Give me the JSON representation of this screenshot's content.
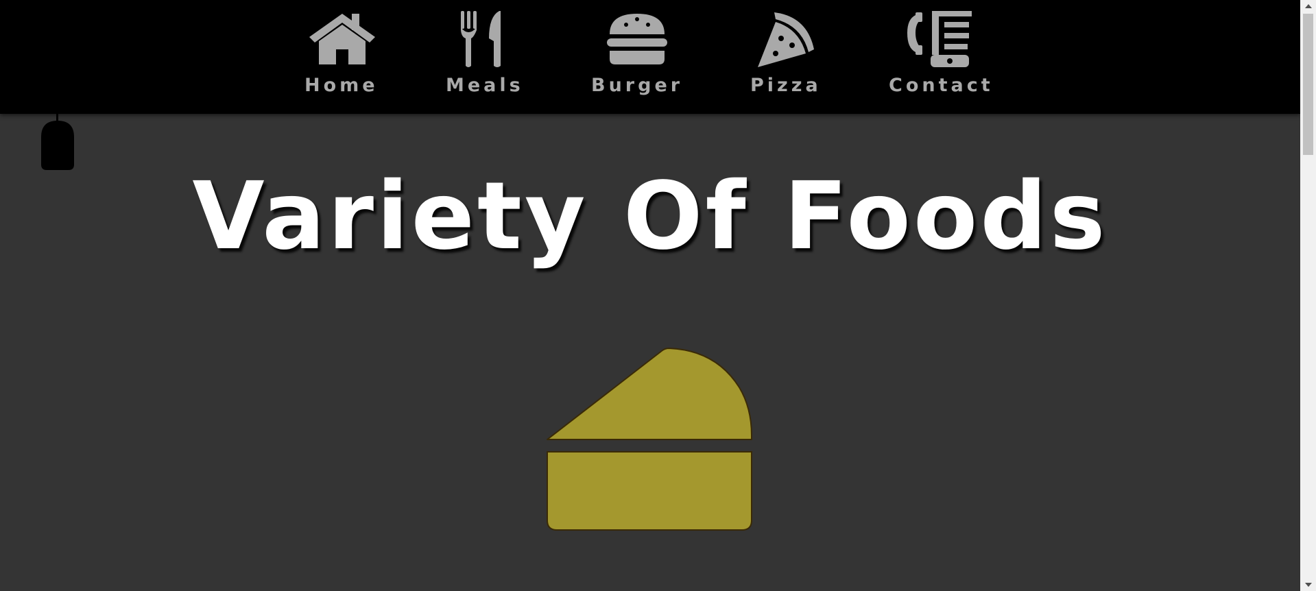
{
  "nav": {
    "items": [
      {
        "label": "Home",
        "icon": "house-icon"
      },
      {
        "label": "Meals",
        "icon": "fork-knife-icon"
      },
      {
        "label": "Burger",
        "icon": "burger-icon"
      },
      {
        "label": "Pizza",
        "icon": "pizza-slice-icon"
      },
      {
        "label": "Contact",
        "icon": "phone-fax-icon"
      }
    ]
  },
  "hero": {
    "title": "Variety Of Foods",
    "icon": "cheese-wedge-icon"
  },
  "colors": {
    "navbar_background": "#000000",
    "page_background": "#343434",
    "nav_text": "#a9a9a9",
    "title_text": "#ffffff",
    "food_icon_fill": "#a4982e",
    "food_icon_outline": "#3a2a06"
  }
}
